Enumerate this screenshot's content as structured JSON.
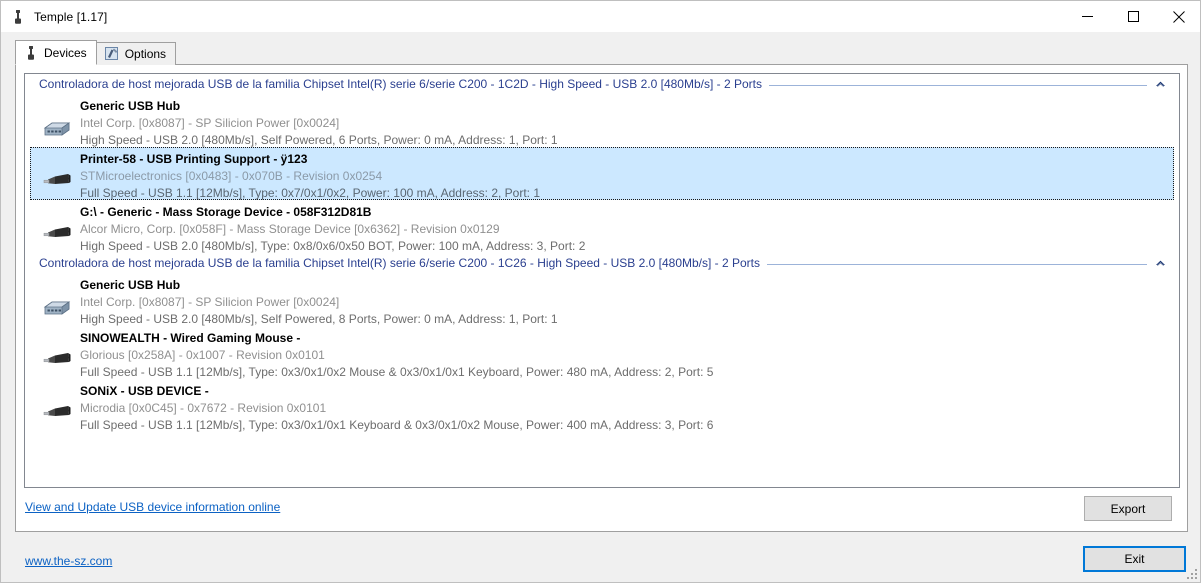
{
  "window": {
    "title": "Temple [1.17]",
    "icon": "usb-icon",
    "minimize_label": "minimize-icon",
    "maximize_label": "maximize-icon",
    "close_label": "close-icon"
  },
  "tabs": [
    {
      "label": "Devices",
      "icon": "usb-icon",
      "active": true
    },
    {
      "label": "Options",
      "icon": "options-icon",
      "active": false
    }
  ],
  "colors": {
    "group_title": "#2a3f8f",
    "selection": "#cce8ff",
    "link": "#0c62c4",
    "focus_border": "#0078d7"
  },
  "groups": [
    {
      "title": "Controladora de host mejorada USB de la familia Chipset Intel(R) serie 6/serie C200 - 1C2D - High Speed - USB 2.0 [480Mb/s] - 2 Ports",
      "collapse_icon": "chevron-up-icon",
      "devices": [
        {
          "icon": "usb-hub-icon",
          "name": "Generic USB Hub",
          "vendor": "Intel Corp. [0x8087] - SP Silicion Power [0x0024]",
          "details": "High Speed - USB 2.0 [480Mb/s], Self Powered, 6 Ports, Power: 0 mA, Address: 1, Port: 1",
          "selected": false
        },
        {
          "icon": "usb-plug-icon",
          "name": "Printer-58 - USB Printing Support - ÿ123",
          "vendor": "STMicroelectronics [0x0483] - 0x070B - Revision 0x0254",
          "details": "Full Speed - USB 1.1 [12Mb/s], Type: 0x7/0x1/0x2, Power: 100 mA, Address: 2, Port: 1",
          "selected": true
        },
        {
          "icon": "usb-plug-icon",
          "name": "G:\\ - Generic - Mass Storage Device - 058F312D81B",
          "vendor": "Alcor Micro, Corp. [0x058F] - Mass Storage Device [0x6362] - Revision 0x0129",
          "details": "High Speed - USB 2.0 [480Mb/s], Type: 0x8/0x6/0x50 BOT, Power: 100 mA, Address: 3, Port: 2",
          "selected": false
        }
      ]
    },
    {
      "title": "Controladora de host mejorada USB de la familia Chipset Intel(R) serie 6/serie C200 - 1C26 - High Speed - USB 2.0 [480Mb/s] - 2 Ports",
      "collapse_icon": "chevron-up-icon",
      "devices": [
        {
          "icon": "usb-hub-icon",
          "name": "Generic USB Hub",
          "vendor": "Intel Corp. [0x8087] - SP Silicion Power [0x0024]",
          "details": "High Speed - USB 2.0 [480Mb/s], Self Powered, 8 Ports, Power: 0 mA, Address: 1, Port: 1",
          "selected": false
        },
        {
          "icon": "usb-plug-icon",
          "name": "SINOWEALTH - Wired Gaming Mouse -",
          "vendor": "Glorious [0x258A] - 0x1007 - Revision 0x0101",
          "details": "Full Speed - USB 1.1 [12Mb/s], Type: 0x3/0x1/0x2 Mouse & 0x3/0x1/0x1 Keyboard, Power: 480 mA, Address: 2, Port: 5",
          "selected": false
        },
        {
          "icon": "usb-plug-icon",
          "name": "SONiX - USB DEVICE -",
          "vendor": "Microdia [0x0C45] - 0x7672 - Revision 0x0101",
          "details": "Full Speed - USB 1.1 [12Mb/s], Type: 0x3/0x1/0x1 Keyboard & 0x3/0x1/0x2 Mouse, Power: 400 mA, Address: 3, Port: 6",
          "selected": false
        }
      ]
    }
  ],
  "page_link": "View and Update USB device information online",
  "export_button": "Export",
  "exit_button": "Exit",
  "bottom_link": "www.the-sz.com"
}
